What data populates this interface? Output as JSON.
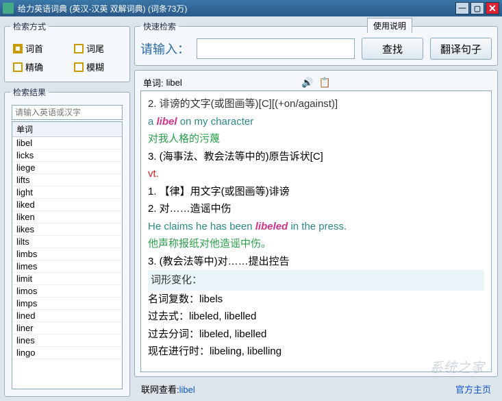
{
  "titlebar": {
    "title": "给力英语词典 (英汉-汉英 双解词典)   (词条73万)"
  },
  "search_mode": {
    "legend": "检索方式",
    "options": [
      {
        "label": "词首",
        "checked": true
      },
      {
        "label": "词尾",
        "checked": false
      },
      {
        "label": "精确",
        "checked": false
      },
      {
        "label": "模糊",
        "checked": false
      }
    ]
  },
  "quick_search": {
    "legend": "快速检索",
    "instruction_tab": "使用说明",
    "input_label": "请输入：",
    "input_value": "",
    "search_btn": "查找",
    "translate_btn": "翻译句子"
  },
  "results": {
    "legend": "检索结果",
    "filter_placeholder": "请输入英语或汉字",
    "header": "单词",
    "words": [
      "libel",
      "licks",
      "liege",
      "lifts",
      "light",
      "liked",
      "liken",
      "likes",
      "lilts",
      "limbs",
      "limes",
      "limit",
      "limos",
      "limps",
      "lined",
      "liner",
      "lines",
      "lingo"
    ]
  },
  "definition": {
    "word_label": "单词:",
    "word_value": "libel",
    "cutoff_line": "2. 诽谤的文字(或图画等)[C][(+on/against)]",
    "lines": [
      {
        "type": "example_en",
        "pre": "a ",
        "hl": "libel",
        "post": " on my character"
      },
      {
        "type": "example_cn",
        "text": "对我人格的污蔑"
      },
      {
        "type": "def",
        "text": "3. (海事法、教会法等中的)原告诉状[C]"
      },
      {
        "type": "vt",
        "text": "vt."
      },
      {
        "type": "def",
        "text": "1. 【律】用文字(或图画等)诽谤"
      },
      {
        "type": "def",
        "text": "2. 对……造谣中伤"
      },
      {
        "type": "example_en",
        "pre": "He claims he has been ",
        "hl": "libeled",
        "post": " in the press."
      },
      {
        "type": "example_cn",
        "text": "他声称报纸对他造谣中伤。"
      },
      {
        "type": "def",
        "text": "3. (教会法等中)对……提出控告"
      },
      {
        "type": "section",
        "text": "词形变化："
      },
      {
        "type": "def",
        "text": "名词复数：libels"
      },
      {
        "type": "def",
        "text": "过去式：libeled, libelled"
      },
      {
        "type": "def",
        "text": "过去分词：libeled, libelled"
      },
      {
        "type": "def",
        "text": "现在进行时：libeling, libelling"
      }
    ]
  },
  "footer": {
    "lookup_label": "联网查看:",
    "lookup_word": "libel",
    "official": "官方主页"
  },
  "watermark": "系统之家"
}
